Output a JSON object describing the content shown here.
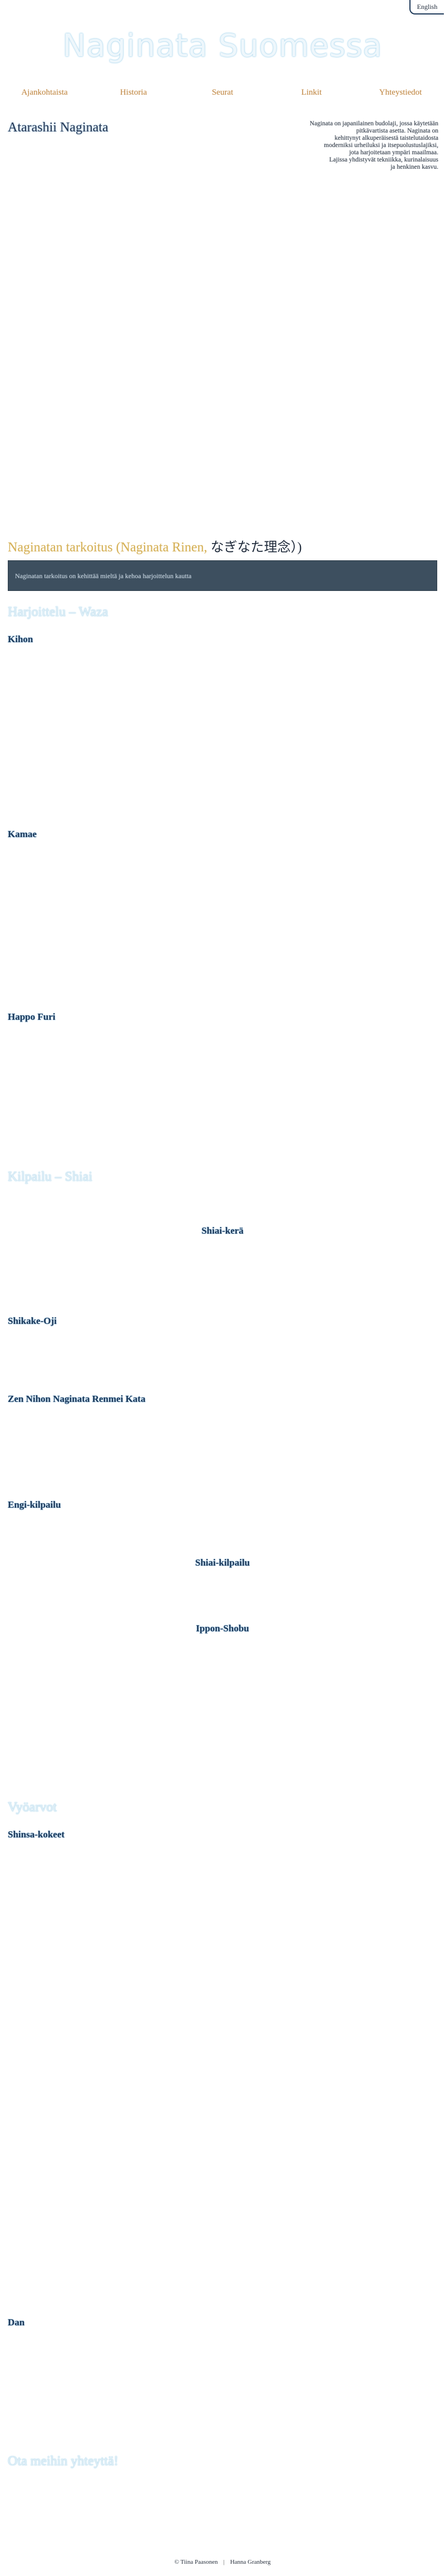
{
  "language_link": "English",
  "site_title": "Naginata Suomessa",
  "nav": {
    "items": [
      {
        "id": "ajankohtaista",
        "label": "Ajankohtaista"
      },
      {
        "id": "historia",
        "label": "Historia"
      },
      {
        "id": "seurat",
        "label": "Seurat"
      },
      {
        "id": "linkit",
        "label": "Linkit"
      },
      {
        "id": "yhteystiedot",
        "label": "Yhteystiedot"
      }
    ]
  },
  "sections": {
    "intro_heading": "Atarashii Naginata",
    "intro_text_lines": [
      "Naginata on japanilainen budolaji, jossa käytetään",
      "pitkävartista asetta. Naginata on",
      "kehittynyt alkuperäisestä taistelutaidosta",
      "moderniksi urheiluksi ja itsepuolustuslajiksi,",
      "jota harjoitetaan ympäri maailmaa.",
      "Lajissa yhdistyvät tekniikka, kurinalaisuus",
      "ja henkinen kasvu."
    ],
    "philosophy_heading_prefix": "Naginatan tarkoitus (Naginata Rinen, ",
    "philosophy_heading_jp": "なぎなた理念）)",
    "philosophy_banner_text": "Naginatan tarkoitus on kehittää mieltä ja kehoa harjoittelun kautta",
    "practice_heading": "Harjoittelu – Waza",
    "practice_subheadings": {
      "shikake_oji": "Kihon",
      "kaeshi": "Kamae",
      "uchi": "Happo Furi"
    },
    "competition_heading": "Kilpailu – Shiai",
    "competition_center_heading": "Shiai-kerä",
    "competition_subheadings": {
      "engi": "Shikake-Oji",
      "kata": "Zen Nihon Naginata Renmei Kata"
    },
    "grading_heading": "Engi-kilpailu",
    "grading_center_heading": "Shiai-kilpailu",
    "grading_center_sub": "Ippon-Shobu",
    "grades_heading": "Vyöarvot",
    "grades_sub1": "Shinsa-kokeet",
    "grades_sub2": "Dan",
    "contact_heading": "Ota meihin yhteyttä!"
  },
  "footer": {
    "copyright": "© Tiina Paasonen",
    "author": "Hanna Granberg"
  },
  "colors": {
    "banner_bg": "#3d4f5f",
    "nav_text": "#c08a4a",
    "title_glow": "#a9d6ee"
  }
}
